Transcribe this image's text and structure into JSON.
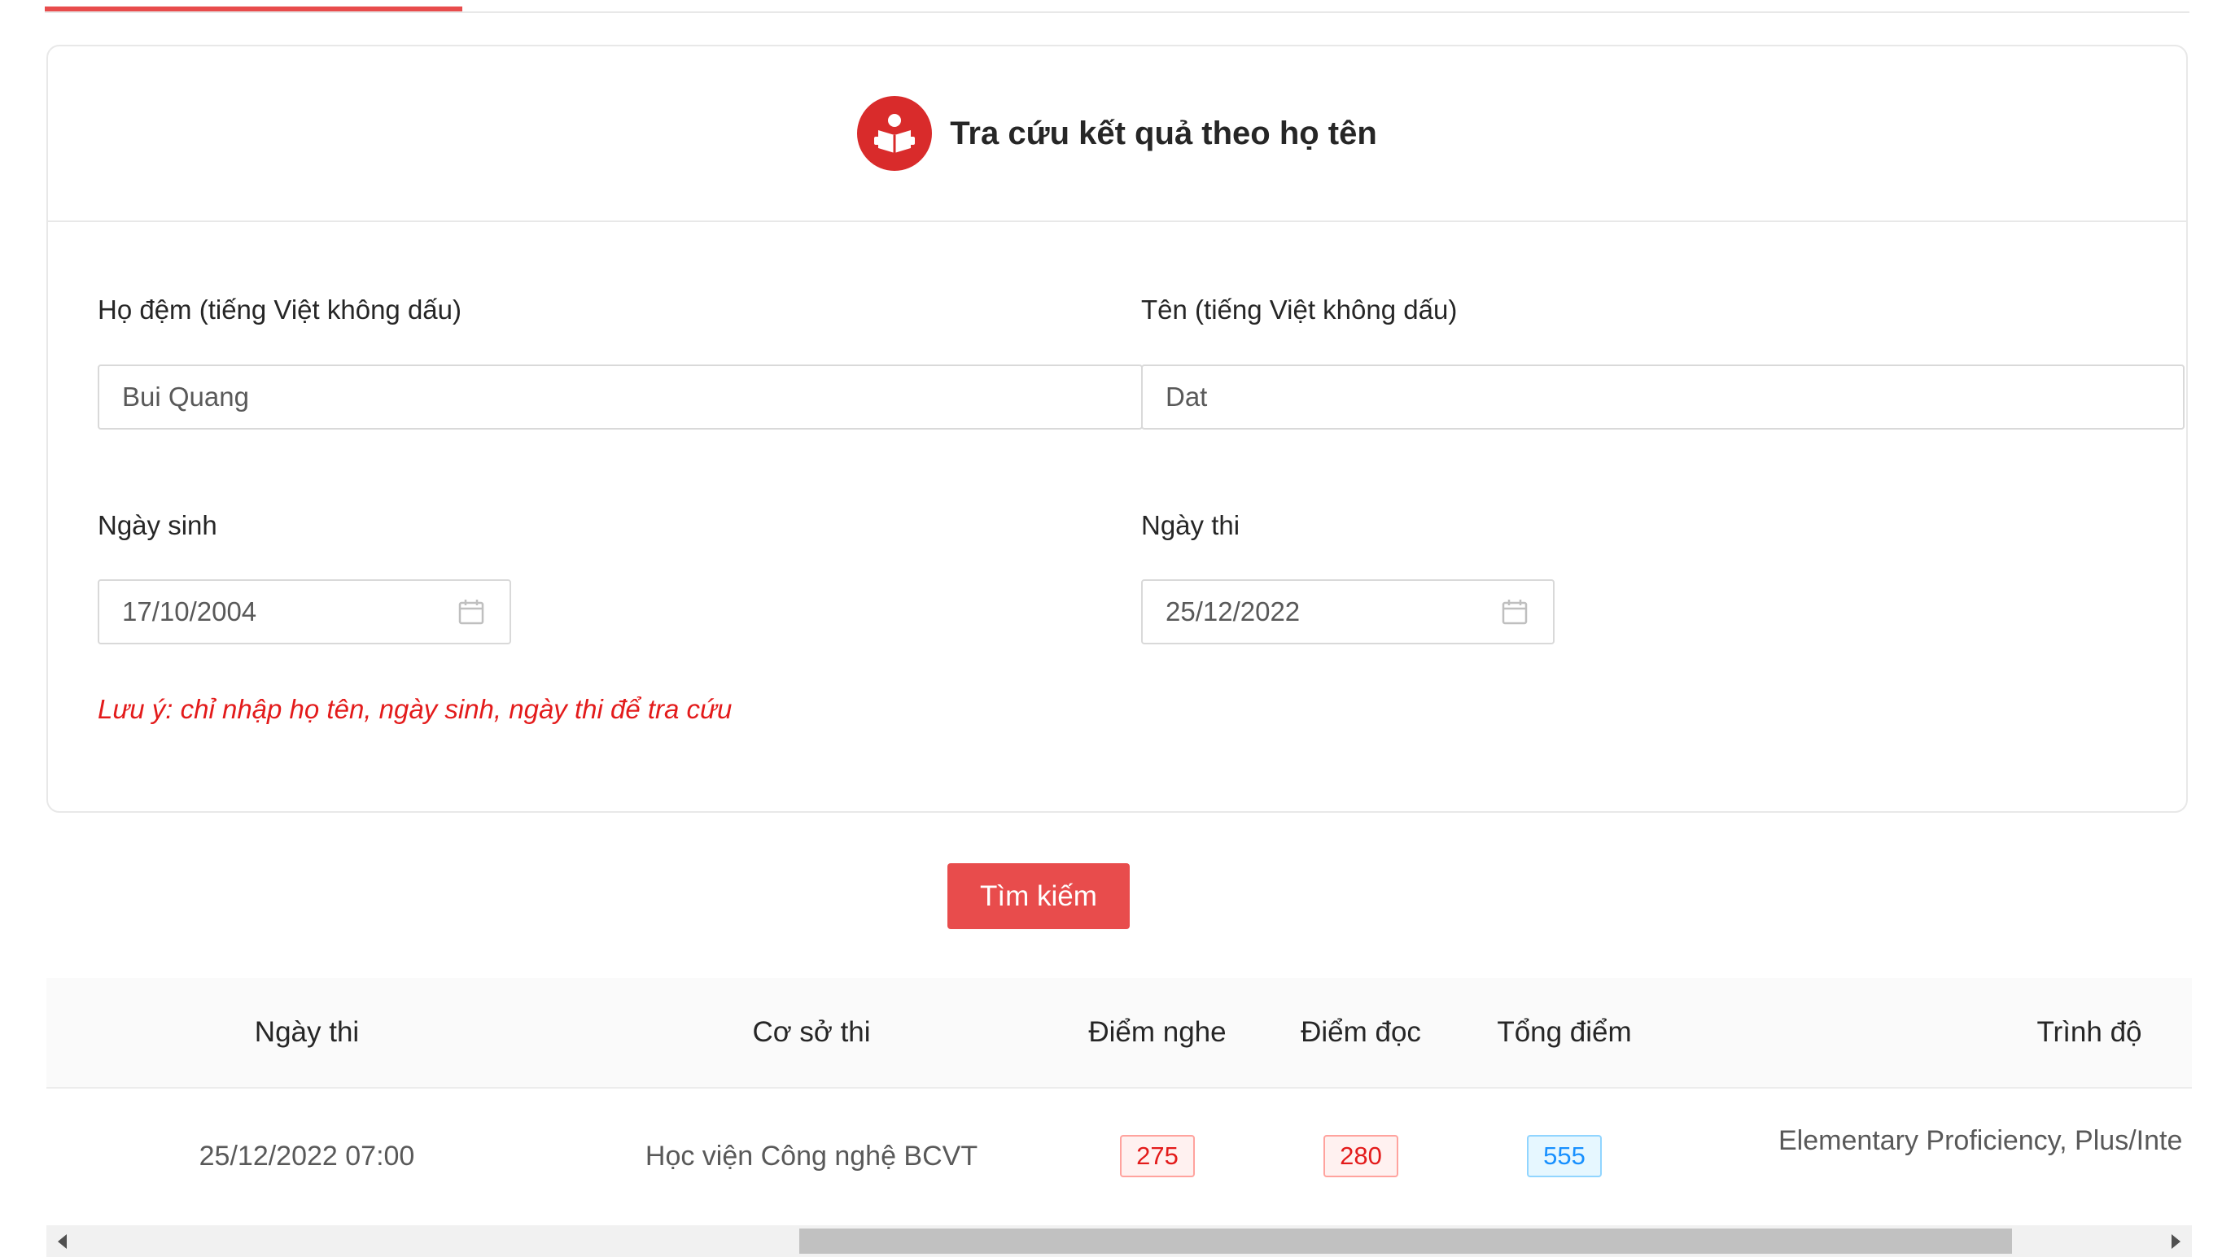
{
  "title": "Tra cứu kết quả theo họ tên",
  "form": {
    "ho_dem_label": "Họ đệm (tiếng Việt không dấu)",
    "ho_dem_value": "Bui Quang",
    "ten_label": "Tên (tiếng Việt không dấu)",
    "ten_value": "Dat",
    "ngay_sinh_label": "Ngày sinh",
    "ngay_sinh_value": "17/10/2004",
    "ngay_thi_label": "Ngày thi",
    "ngay_thi_value": "25/12/2022",
    "note": "Lưu ý: chỉ nhập họ tên, ngày sinh, ngày thi để tra cứu"
  },
  "search_button": "Tìm kiếm",
  "table": {
    "columns": [
      "Ngày thi",
      "Cơ sở thi",
      "Điểm nghe",
      "Điểm đọc",
      "Tổng điểm",
      "Trình độ"
    ],
    "rows": [
      {
        "ngay_thi": "25/12/2022 07:00",
        "co_so_thi": "Học viện Công nghệ BCVT",
        "diem_nghe": "275",
        "diem_doc": "280",
        "tong_diem": "555",
        "trinh_do": "Elementary Proficiency, Plus/Inte"
      }
    ]
  },
  "icons": {
    "header": "reading-book-icon",
    "date": "calendar-icon"
  },
  "colors": {
    "accent": "#e84c4c",
    "icon_bg": "#d92b2b",
    "note": "#e31b1b",
    "tag_red": "#e31b1b",
    "tag_blue": "#1890ff"
  }
}
